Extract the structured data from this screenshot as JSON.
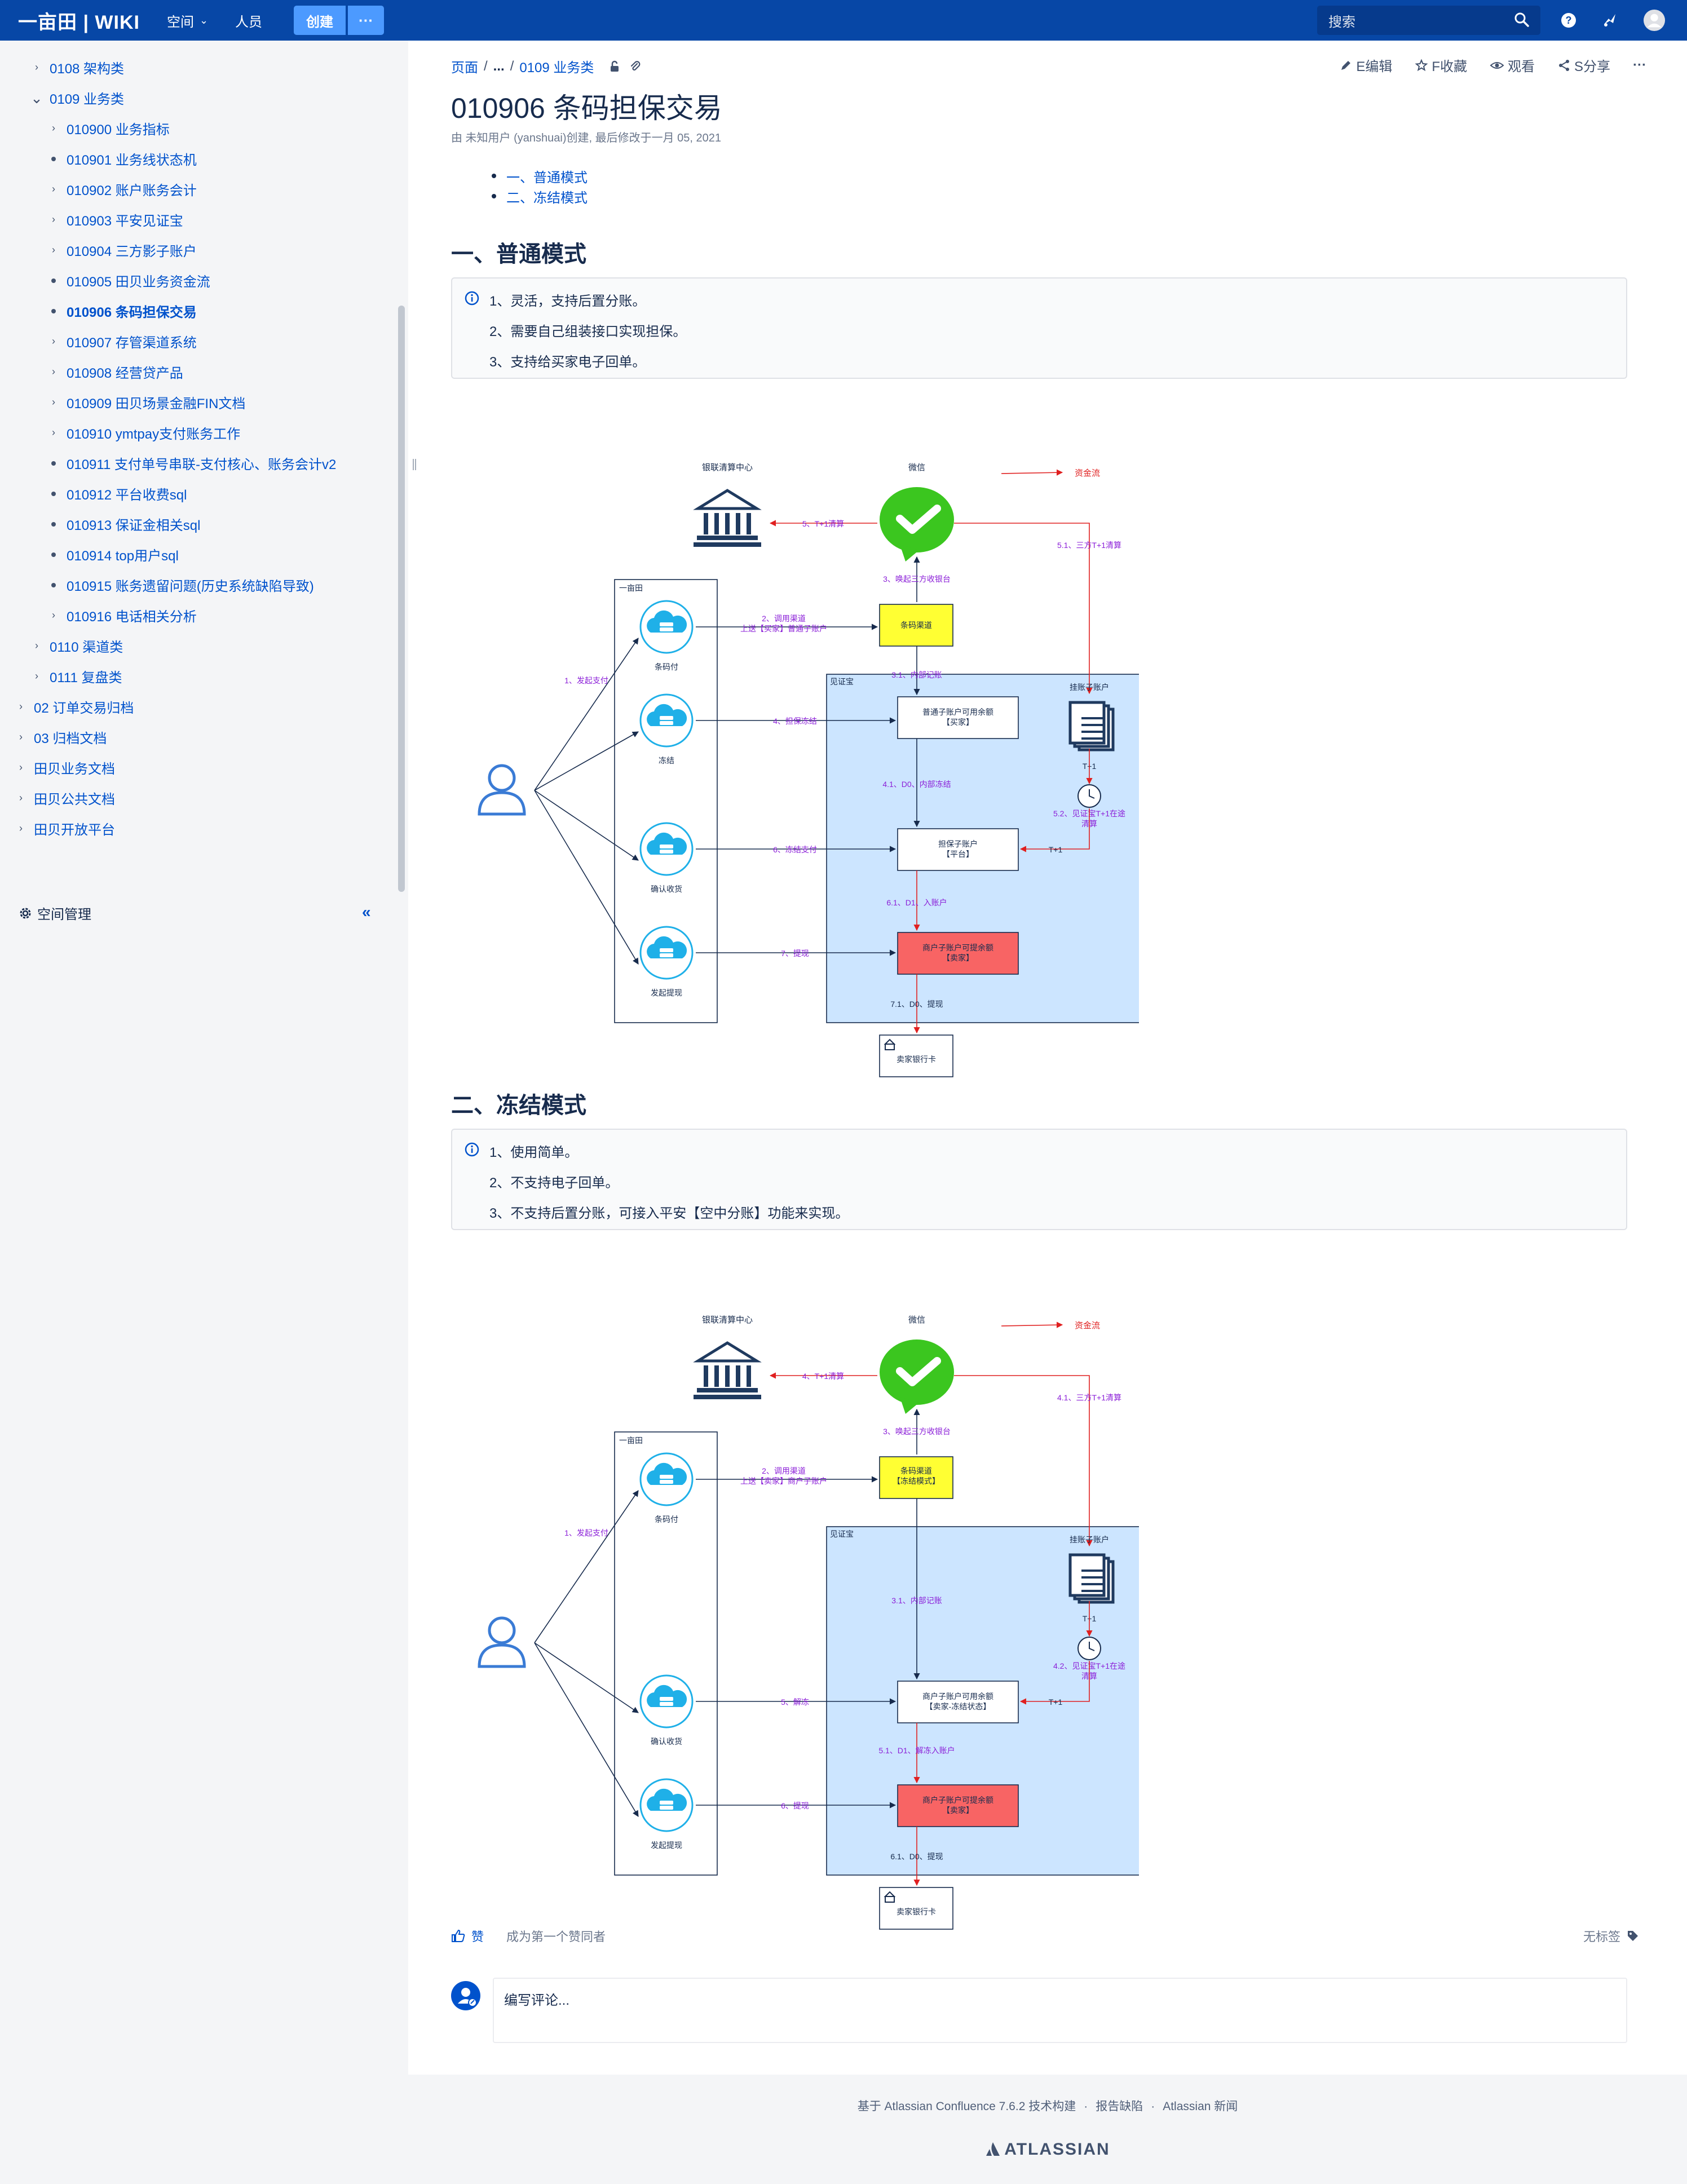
{
  "topbar": {
    "brand": "一亩田 | WIKI",
    "nav_space": "空间",
    "nav_people": "人员",
    "create": "创建",
    "more": "···",
    "search_placeholder": "搜索"
  },
  "sidebar": {
    "items": [
      {
        "label": "0108 架构类",
        "mark": "chevron-right",
        "level": 1
      },
      {
        "label": "0109 业务类",
        "mark": "chevron-down",
        "level": 1
      },
      {
        "label": "010900 业务指标",
        "mark": "chevron-right",
        "level": 2
      },
      {
        "label": "010901 业务线状态机",
        "mark": "dot",
        "level": 2
      },
      {
        "label": "010902 账户账务会计",
        "mark": "chevron-right",
        "level": 2
      },
      {
        "label": "010903 平安见证宝",
        "mark": "chevron-right",
        "level": 2
      },
      {
        "label": "010904 三方影子账户",
        "mark": "chevron-right",
        "level": 2
      },
      {
        "label": "010905 田贝业务资金流",
        "mark": "dot",
        "level": 2
      },
      {
        "label": "010906 条码担保交易",
        "mark": "dot",
        "level": 2,
        "active": true
      },
      {
        "label": "010907 存管渠道系统",
        "mark": "chevron-right",
        "level": 2
      },
      {
        "label": "010908 经营贷产品",
        "mark": "chevron-right",
        "level": 2
      },
      {
        "label": "010909 田贝场景金融FIN文档",
        "mark": "chevron-right",
        "level": 2
      },
      {
        "label": "010910 ymtpay支付账务工作",
        "mark": "chevron-right",
        "level": 2
      },
      {
        "label": "010911 支付单号串联-支付核心、账务会计v2",
        "mark": "dot",
        "level": 2
      },
      {
        "label": "010912 平台收费sql",
        "mark": "dot",
        "level": 2
      },
      {
        "label": "010913 保证金相关sql",
        "mark": "dot",
        "level": 2
      },
      {
        "label": "010914 top用户sql",
        "mark": "dot",
        "level": 2
      },
      {
        "label": "010915 账务遗留问题(历史系统缺陷导致)",
        "mark": "dot",
        "level": 2
      },
      {
        "label": "010916 电话相关分析",
        "mark": "chevron-right",
        "level": 2
      },
      {
        "label": "0110 渠道类",
        "mark": "chevron-right",
        "level": 1
      },
      {
        "label": "0111 复盘类",
        "mark": "chevron-right",
        "level": 1
      },
      {
        "label": "02 订单交易归档",
        "mark": "chevron-right",
        "level": 0
      },
      {
        "label": "03 归档文档",
        "mark": "chevron-right",
        "level": 0
      },
      {
        "label": "田贝业务文档",
        "mark": "chevron-right",
        "level": 0
      },
      {
        "label": "田贝公共文档",
        "mark": "chevron-right",
        "level": 0
      },
      {
        "label": "田贝开放平台",
        "mark": "chevron-right",
        "level": 0
      }
    ],
    "space_admin": "空间管理"
  },
  "breadcrumb": [
    "页面",
    "...",
    "0109 业务类"
  ],
  "page_actions": {
    "edit": "E编辑",
    "favorite": "F收藏",
    "watch": "观看",
    "share": "S分享",
    "more": "···"
  },
  "page": {
    "title": "010906 条码担保交易",
    "byline": "由 未知用户 (yanshuai)创建, 最后修改于一月 05, 2021",
    "toc": [
      "一、普通模式",
      "二、冻结模式"
    ]
  },
  "section1": {
    "heading": "一、普通模式",
    "info_lines": [
      "1、灵活，支持后置分账。",
      "2、需要自己组装接口实现担保。",
      "3、支持给买家电子回单。"
    ],
    "diagram": {
      "unionpay": "银联清算中心",
      "wechat": "微信",
      "legend": "资金流",
      "ymt_box": "一亩田",
      "witness_box": "见证宝",
      "barcode_pay": "条码付",
      "freeze": "冻结",
      "confirm": "确认收货",
      "withdraw": "发起提现",
      "channel": "条码渠道",
      "buyer_acct": "普通子账户可用余额\n【买家】",
      "guarantee_acct": "担保子账户\n【平台】",
      "merchant_acct": "商户子账户可提余额\n【卖家】",
      "hang_acct": "挂账子账户",
      "bank_card": "卖家银行卡",
      "e1": "1、发起支付",
      "e2": "2、调用渠道\n上送【买家】普通子账户",
      "e3": "3、唤起三方收银台",
      "e31": "3.1、内部记账",
      "e4": "4、担保冻结",
      "e41": "4.1、D0、内部冻结",
      "e5": "5、T+1清算",
      "e51": "5.1、三方T+1清算",
      "e52": "5.2、见证宝T+1在途\n清算",
      "e6": "6、冻结支付",
      "e61": "6.1、D1、入账户",
      "e7": "7、提现",
      "e71": "7.1、D0、提现",
      "t1a": "T+1",
      "t1b": "T+1"
    }
  },
  "section2": {
    "heading": "二、冻结模式",
    "info_lines": [
      "1、使用简单。",
      "2、不支持电子回单。",
      "3、不支持后置分账，可接入平安【空中分账】功能来实现。"
    ],
    "diagram": {
      "unionpay": "银联清算中心",
      "wechat": "微信",
      "legend": "资金流",
      "ymt_box": "一亩田",
      "witness_box": "见证宝",
      "barcode_pay": "条码付",
      "confirm": "确认收货",
      "withdraw": "发起提现",
      "channel": "条码渠道\n【冻结模式】",
      "merchant_frozen": "商户子账户可用余额\n【卖家-冻结状态】",
      "merchant_acct": "商户子账户可提余额\n【卖家】",
      "hang_acct": "挂账子账户",
      "bank_card": "卖家银行卡",
      "e1": "1、发起支付",
      "e2": "2、调用渠道\n上送【卖家】商户子账户",
      "e3": "3、唤起三方收银台",
      "e31": "3.1、内部记账",
      "e4": "4、T+1清算",
      "e41": "4.1、三方T+1清算",
      "e42": "4.2、见证宝T+1在途\n清算",
      "e5": "5、解冻",
      "e51": "5.1、D1、解冻入账户",
      "e6": "6、提现",
      "e61": "6.1、D0、提现",
      "t1a": "T+1",
      "t1b": "T+1"
    }
  },
  "footer": {
    "like": "赞",
    "first_liker": "成为第一个赞同者",
    "no_labels": "无标签",
    "comment_placeholder": "编写评论...",
    "links": [
      "基于 Atlassian Confluence 7.6.2 技术构建",
      "报告缺陷",
      "Atlassian 新闻"
    ],
    "logo": "ATLASSIAN"
  },
  "colors": {
    "nav": "#0747a6",
    "link": "#0052cc",
    "flow_red": "#e02020",
    "purple": "#8b1fd8",
    "yellow": "#ffff33",
    "red_box": "#f86464",
    "blue_zone": "#cce5ff"
  }
}
